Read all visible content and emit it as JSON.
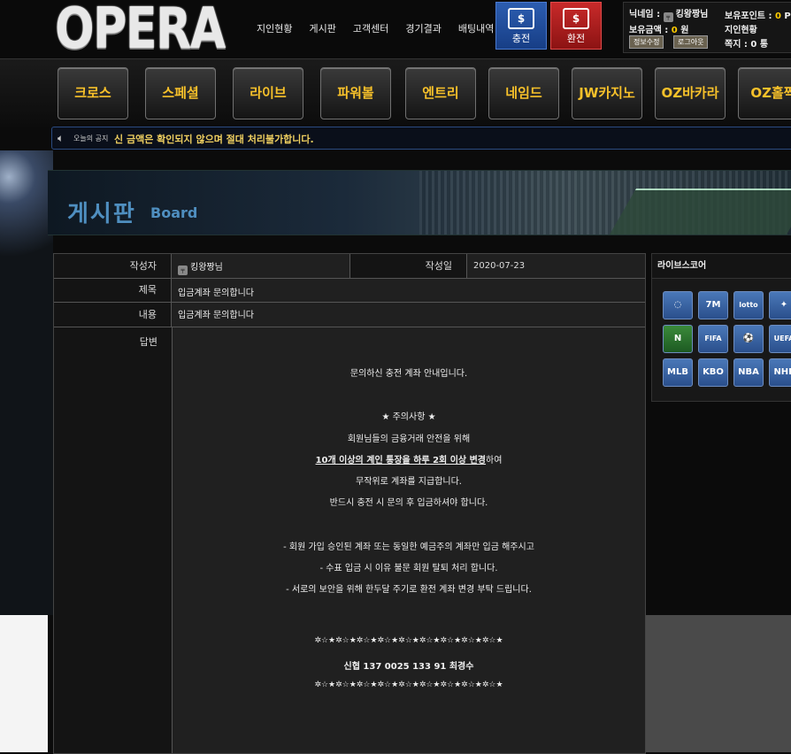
{
  "header": {
    "logo_text": "OPERA",
    "topnav": [
      "지인현황",
      "게시판",
      "고객센터",
      "경기결과",
      "배팅내역"
    ],
    "charge_label": "충전",
    "exchange_label": "환전",
    "user": {
      "nickname_label": "닉네임 :",
      "nickname": "킹왕짱님",
      "balance_label": "보유금액 :",
      "balance_value": "0",
      "balance_unit": "원",
      "points_label": "보유포인트 :",
      "points_value": "0",
      "points_unit": "P",
      "referral_label": "지인현황",
      "memo_label": "쪽지 :",
      "memo_value": "0",
      "memo_unit": "통",
      "edit_info_label": "정보수정",
      "logout_label": "로그아웃"
    }
  },
  "game_menu": [
    "크로스",
    "스페셜",
    "라이브",
    "파워볼",
    "엔트리",
    "네임드",
    "JW카지노",
    "OZ바카라",
    "OZ홀짝"
  ],
  "notice": {
    "label": "오늘의 공지",
    "text": "신 금액은 확인되지 않으며 절대 처리불가합니다."
  },
  "board_banner": {
    "title_ko": "게시판",
    "title_en": "Board"
  },
  "post": {
    "author_label": "작성자",
    "author": "킹왕짱님",
    "date_label": "작성일",
    "date": "2020-07-23",
    "subject_label": "제목",
    "subject": "입금계좌 문의합니다",
    "content_label": "내용",
    "content": "입금계좌 문의합니다",
    "answer_label": "답변",
    "answer_lines": {
      "l1": "문의하신 충전 계좌 안내입니다.",
      "l2": "★ 주의사항 ★",
      "l3": "회원님들의 금융거래 안전을 위해",
      "l4_underlined": "10개 이상의 계인 통장을 하루 2회 이상 변경",
      "l4_rest": "하여",
      "l5": "무작위로 계좌를 지급합니다.",
      "l6": "반드시 충전 시 문의 후 입금하셔야 합니다.",
      "l7": "- 회원 가입 승인된 계좌 또는 동일한 예금주의 계좌만 입금 해주시고",
      "l8": "- 수표 입금 시 이유 불문 회원 탈퇴 처리 합니다.",
      "l9": "- 서로의 보안을 위해 한두달 주기로 환전 계좌 변경 부탁 드립니다.",
      "stars_top": "✲☆★✲☆★✲☆★✲☆★✲☆★✲☆★✲☆★✲☆★✲☆★",
      "account": "신협   137 0025 133 91   최경수",
      "stars_bottom": "✲☆★✲☆★✲☆★✲☆★✲☆★✲☆★✲☆★✲☆★✲☆★"
    }
  },
  "live_score": {
    "title": "라이브스코어",
    "icons": [
      "livescore-icon",
      "7m-icon",
      "lotto-icon",
      "nowgoal-icon",
      "naver-icon",
      "fifa-icon",
      "uefa-champions-icon",
      "uefa-icon",
      "mlb-icon",
      "kbo-icon",
      "nba-icon",
      "nhl-icon"
    ],
    "icon_labels": [
      "◌",
      "7M",
      "lotto",
      "✦",
      "N",
      "FIFA",
      "⚽",
      "UEFA",
      "MLB",
      "KBO",
      "NBA",
      "NHL"
    ]
  }
}
